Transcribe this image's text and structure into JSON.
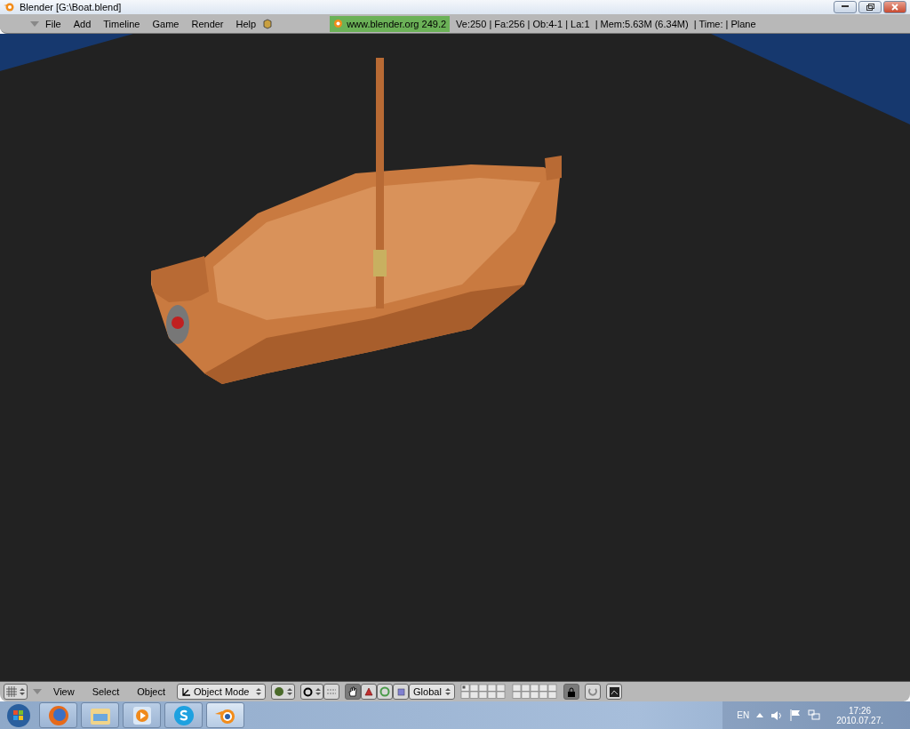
{
  "window": {
    "title": "Blender [G:\\Boat.blend]"
  },
  "menu": [
    {
      "label": "File"
    },
    {
      "label": "Add"
    },
    {
      "label": "Timeline"
    },
    {
      "label": "Game"
    },
    {
      "label": "Render"
    },
    {
      "label": "Help"
    }
  ],
  "info": {
    "version": "www.blender.org 249.2",
    "stats": "Ve:250 | Fa:256 | Ob:4-1 | La:1  | Mem:5.63M (6.34M)  | Time: | Plane"
  },
  "view_header": {
    "menus": [
      "View",
      "Select",
      "Object"
    ],
    "mode": "Object Mode",
    "orientation": "Global",
    "manipulators": [
      {
        "kind": "hand",
        "selected": true
      },
      {
        "kind": "translate",
        "selected": false
      },
      {
        "kind": "rotate",
        "selected": false
      },
      {
        "kind": "scale",
        "selected": false
      }
    ],
    "lock": {
      "selected": true
    }
  },
  "taskbar": {
    "apps": [
      {
        "kind": "browser",
        "selected": false
      },
      {
        "kind": "folder",
        "selected": false
      },
      {
        "kind": "player",
        "selected": false
      },
      {
        "kind": "chat",
        "selected": false
      },
      {
        "kind": "blender",
        "selected": true
      }
    ],
    "language": "EN",
    "time": "17:26",
    "date": "2010.07.27."
  }
}
